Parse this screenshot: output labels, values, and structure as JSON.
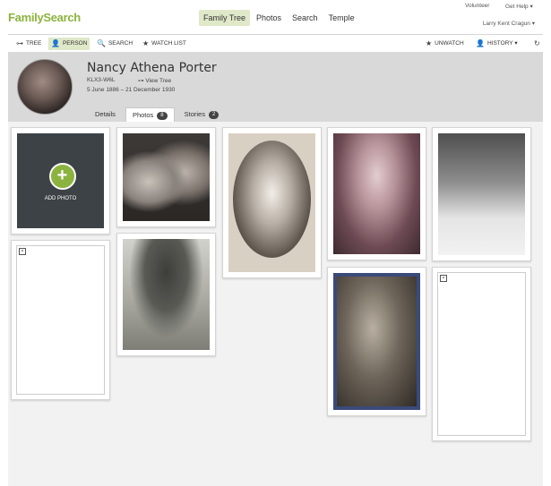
{
  "brand": {
    "name": "FamilySearch",
    "color": "#8cb33f"
  },
  "nav": {
    "items": [
      "Family Tree",
      "Photos",
      "Search",
      "Temple"
    ],
    "active": "Family Tree"
  },
  "util": {
    "volunteer": "Volunteer",
    "help": "Get Help ▾",
    "user": "Larry Kent Cragun ▾"
  },
  "toolbar": {
    "tree": "TREE",
    "person": "PERSON",
    "search": "SEARCH",
    "watch": "WATCH LIST",
    "unwatch": "UNWATCH",
    "history": "HISTORY ▾"
  },
  "person": {
    "name": "Nancy Athena Porter",
    "id": "KLX3-W6L",
    "view_tree": "View Tree",
    "dates": "5 June 1886 – 21 December 1930"
  },
  "tabs": {
    "details": "Details",
    "photos": "Photos",
    "photos_count": "8",
    "stories": "Stories",
    "stories_count": "2"
  },
  "add_photo": "ADD PHOTO",
  "icons": {
    "tree": "tree-icon",
    "person": "person-icon",
    "search": "search-icon",
    "watch": "star-icon",
    "unwatch": "star-icon",
    "history": "person-icon",
    "refresh": "refresh-icon"
  }
}
